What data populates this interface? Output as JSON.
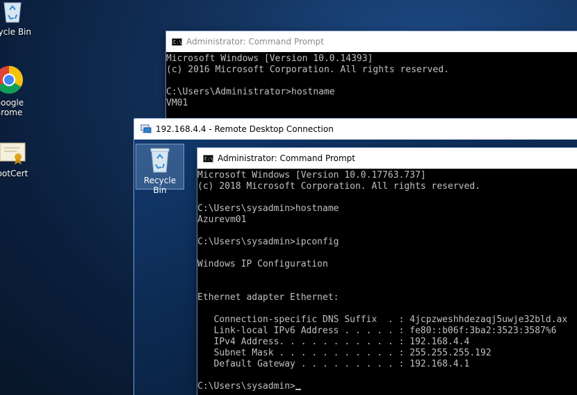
{
  "desktop": {
    "icons": [
      {
        "label": "cycle Bin"
      },
      {
        "label_line1": "Google",
        "label_line2": "hrome"
      },
      {
        "label": "ootCert"
      }
    ]
  },
  "cmd_outer": {
    "title": "Administrator: Command Prompt",
    "lines": [
      "Microsoft Windows [Version 10.0.14393]",
      "(c) 2016 Microsoft Corporation. All rights reserved.",
      "",
      "C:\\Users\\Administrator>hostname",
      "VM01"
    ]
  },
  "rdp": {
    "title": "192.168.4.4 - Remote Desktop Connection",
    "recycle_bin_label": "Recycle Bin"
  },
  "cmd_inner": {
    "title": "Administrator: Command Prompt",
    "lines": [
      "Microsoft Windows [Version 10.0.17763.737]",
      "(c) 2018 Microsoft Corporation. All rights reserved.",
      "",
      "C:\\Users\\sysadmin>hostname",
      "Azurevm01",
      "",
      "C:\\Users\\sysadmin>ipconfig",
      "",
      "Windows IP Configuration",
      "",
      "",
      "Ethernet adapter Ethernet:",
      "",
      "   Connection-specific DNS Suffix  . : 4jcpzweshhdezaqj5uwje32bld.ax",
      "   Link-local IPv6 Address . . . . . : fe80::b06f:3ba2:3523:3587%6",
      "   IPv4 Address. . . . . . . . . . . : 192.168.4.4",
      "   Subnet Mask . . . . . . . . . . . : 255.255.255.192",
      "   Default Gateway . . . . . . . . . : 192.168.4.1",
      ""
    ],
    "prompt": "C:\\Users\\sysadmin>"
  }
}
